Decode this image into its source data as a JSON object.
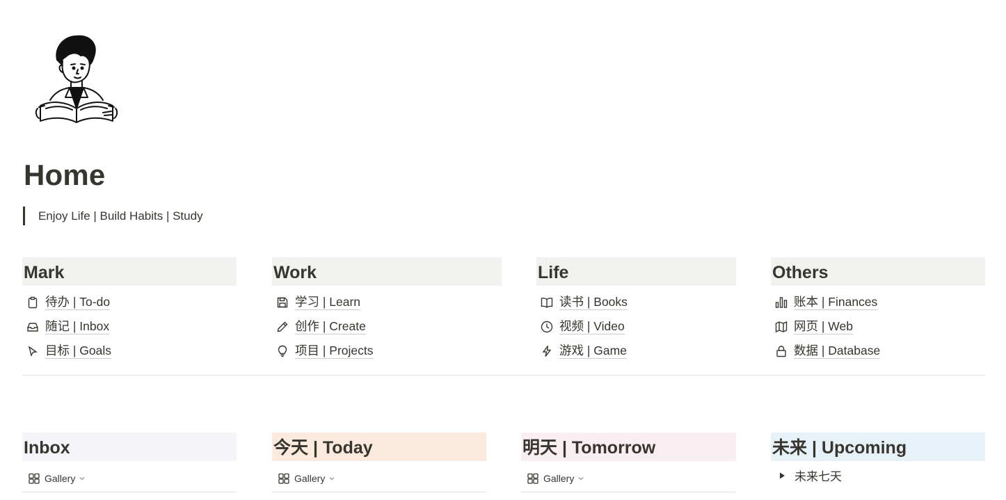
{
  "page": {
    "title": "Home",
    "quote": "Enjoy Life | Build Habits | Study"
  },
  "sections": [
    {
      "heading": "Mark",
      "links": [
        {
          "icon": "clipboard-icon",
          "label": "待办 | To-do"
        },
        {
          "icon": "inbox-icon",
          "label": "随记 | Inbox"
        },
        {
          "icon": "cursor-icon",
          "label": "目标 | Goals"
        }
      ]
    },
    {
      "heading": "Work",
      "links": [
        {
          "icon": "save-icon",
          "label": "学习 | Learn"
        },
        {
          "icon": "pencil-icon",
          "label": "创作 | Create"
        },
        {
          "icon": "lightbulb-icon",
          "label": "项目 | Projects"
        }
      ]
    },
    {
      "heading": "Life",
      "links": [
        {
          "icon": "book-icon",
          "label": "读书 | Books"
        },
        {
          "icon": "clock-icon",
          "label": "视频 | Video"
        },
        {
          "icon": "lightning-icon",
          "label": "游戏 | Game"
        }
      ]
    },
    {
      "heading": "Others",
      "links": [
        {
          "icon": "bar-chart-icon",
          "label": "账本 | Finances"
        },
        {
          "icon": "map-icon",
          "label": "网页 | Web"
        },
        {
          "icon": "lock-icon",
          "label": "数据 | Database"
        }
      ]
    }
  ],
  "databases": [
    {
      "heading": "Inbox",
      "bg": "#f5f4f8",
      "view_label": "Gallery"
    },
    {
      "heading": "今天 | Today",
      "bg": "#fbeadd",
      "view_label": "Gallery"
    },
    {
      "heading": "明天 | Tomorrow",
      "bg": "#f9eef1",
      "view_label": "Gallery"
    },
    {
      "heading": "未来 | Upcoming",
      "bg": "#e7f2f8",
      "toggle_label": "未来七天"
    }
  ],
  "colors": {
    "text": "#37352f",
    "section_bg": "#f1f1ef",
    "divider": "#e3e2e0"
  }
}
